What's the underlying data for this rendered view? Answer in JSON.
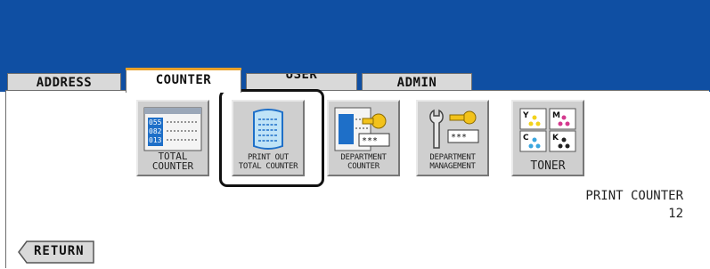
{
  "tabs": [
    {
      "label": "ADDRESS"
    },
    {
      "label": "COUNTER"
    },
    {
      "label": "USER"
    },
    {
      "label": "ADMIN"
    }
  ],
  "buttons": [
    {
      "label": "TOTAL\nCOUNTER",
      "icon": "total-counter-icon"
    },
    {
      "label": "PRINT OUT\nTOTAL COUNTER",
      "icon": "print-out-icon"
    },
    {
      "label": "DEPARTMENT\nCOUNTER",
      "icon": "department-counter-icon"
    },
    {
      "label": "DEPARTMENT\nMANAGEMENT",
      "icon": "wrench-key-icon"
    },
    {
      "label": "TONER",
      "icon": "toner-icon"
    }
  ],
  "toner_letters": [
    "Y",
    "M",
    "C",
    "K"
  ],
  "total_counter_digits": [
    "055",
    "082",
    "013"
  ],
  "masked_code": "***",
  "status": {
    "title": "PRINT COUNTER",
    "value": "12"
  },
  "return_label": "RETURN",
  "colors": {
    "top_band": "#0f4fa3",
    "active_tab_accent": "#e8a12a",
    "button_face": "#cfcfcf",
    "toner_yellow": "#f2d21b",
    "toner_magenta": "#d4398e",
    "toner_cyan": "#3aa6de",
    "toner_black": "#222222"
  }
}
